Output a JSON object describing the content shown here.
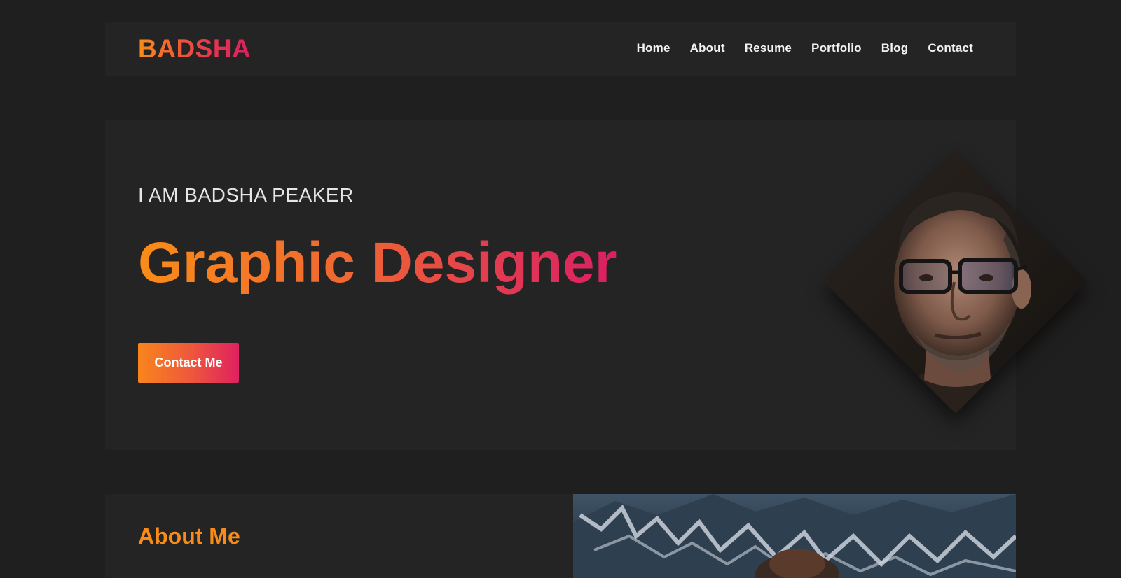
{
  "header": {
    "logo": "BADSHA",
    "nav": [
      {
        "label": "Home"
      },
      {
        "label": "About"
      },
      {
        "label": "Resume"
      },
      {
        "label": "Portfolio"
      },
      {
        "label": "Blog"
      },
      {
        "label": "Contact"
      }
    ]
  },
  "hero": {
    "intro": "I AM BADSHA PEAKER",
    "role": "Graphic Designer",
    "cta_label": "Contact Me"
  },
  "about": {
    "title": "About Me"
  },
  "colors": {
    "background": "#1f1f1f",
    "panel": "#242424",
    "accent_orange": "#f98c19",
    "accent_pink": "#dc1f5f"
  }
}
